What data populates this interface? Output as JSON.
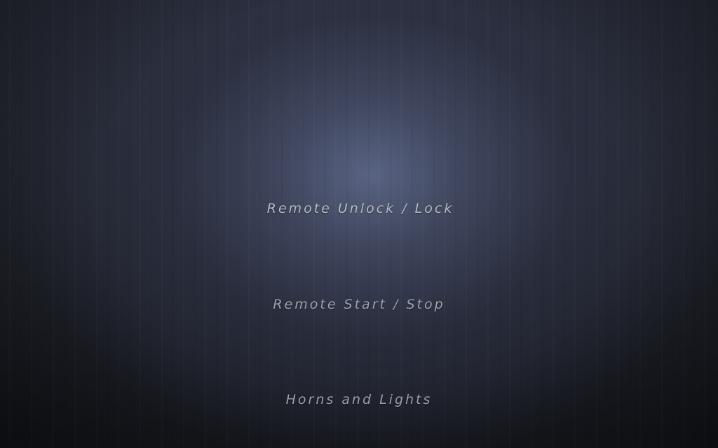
{
  "menu": {
    "items": [
      {
        "label": "Remote Unlock / Lock"
      },
      {
        "label": "Remote Start / Stop"
      },
      {
        "label": "Horns and Lights"
      }
    ]
  },
  "colors": {
    "background": "#23262f",
    "glow": "#626e91",
    "text": "#a9adb8"
  }
}
